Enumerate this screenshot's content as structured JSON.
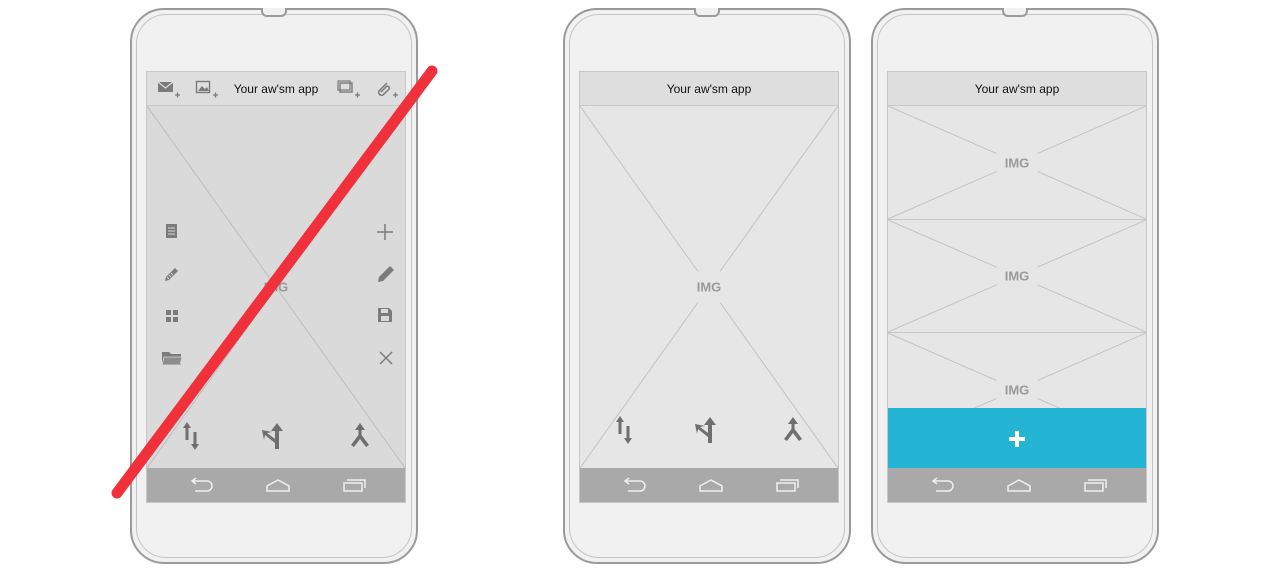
{
  "app_title": "Your aw'sm app",
  "image_placeholder_label": "IMG",
  "colors": {
    "strike": "#f0303a",
    "fab": "#23b5d3",
    "icon_gray": "#7b7b7b",
    "nav_bar": "#a9a9a9"
  },
  "phones": [
    {
      "name": "cluttered-design",
      "struck_out": true,
      "top_actions": [
        "mail-add-icon",
        "image-add-icon",
        "slideshow-add-icon",
        "attachment-add-icon"
      ],
      "left_actions": [
        "document-icon",
        "edit-icon",
        "grid-icon",
        "folder-icon"
      ],
      "right_actions": [
        "add-icon",
        "pencil-icon",
        "save-icon",
        "close-icon"
      ],
      "bottom_actions": [
        "swap-vertical-icon",
        "turn-icon",
        "merge-icon"
      ]
    },
    {
      "name": "simplified-design",
      "struck_out": false,
      "bottom_actions": [
        "swap-vertical-icon",
        "turn-icon",
        "merge-icon"
      ]
    },
    {
      "name": "list-design",
      "struck_out": false,
      "image_count": 3,
      "fab_icon": "plus-icon"
    }
  ],
  "nav_buttons": [
    "back-icon",
    "home-icon",
    "recent-apps-icon"
  ]
}
